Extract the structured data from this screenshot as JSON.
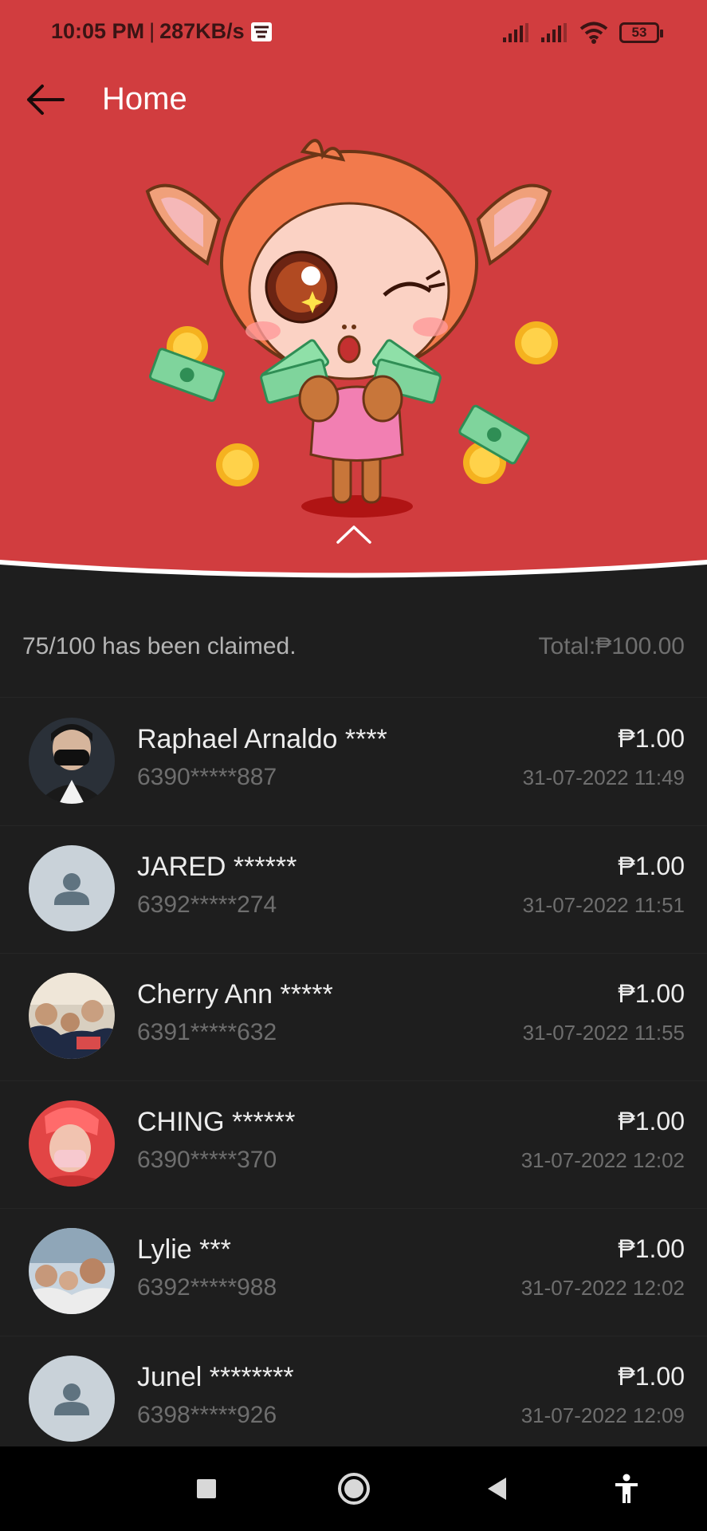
{
  "status_bar": {
    "time": "10:05 PM",
    "speed": "287KB/s",
    "battery": "53",
    "icons": [
      "signal-icon",
      "signal-icon",
      "wifi-icon",
      "battery-icon"
    ]
  },
  "header": {
    "title": "Home",
    "back_icon": "arrow-left-icon",
    "collapse_icon": "chevron-up-icon"
  },
  "colors": {
    "hero_bg": "#d13d3f",
    "list_bg": "#1e1e1e",
    "nav_bg": "#000000"
  },
  "summary": {
    "claimed": "75/100 has been claimed.",
    "total": "Total:₱100.00"
  },
  "claims": [
    {
      "name": "Raphael Arnaldo ****",
      "phone": "6390*****887",
      "amount": "₱1.00",
      "time": "31-07-2022 11:49",
      "avatar": "photo"
    },
    {
      "name": "JARED ******",
      "phone": "6392*****274",
      "amount": "₱1.00",
      "time": "31-07-2022 11:51",
      "avatar": "placeholder"
    },
    {
      "name": "Cherry Ann *****",
      "phone": "6391*****632",
      "amount": "₱1.00",
      "time": "31-07-2022 11:55",
      "avatar": "photo"
    },
    {
      "name": "CHING ******",
      "phone": "6390*****370",
      "amount": "₱1.00",
      "time": "31-07-2022 12:02",
      "avatar": "photo"
    },
    {
      "name": "Lylie ***",
      "phone": "6392*****988",
      "amount": "₱1.00",
      "time": "31-07-2022 12:02",
      "avatar": "photo"
    },
    {
      "name": "Junel ********",
      "phone": "6398*****926",
      "amount": "₱1.00",
      "time": "31-07-2022 12:09",
      "avatar": "placeholder"
    }
  ],
  "nav_bar": {
    "icons": [
      "recents-square-icon",
      "home-circle-icon",
      "back-triangle-icon",
      "accessibility-icon"
    ]
  }
}
